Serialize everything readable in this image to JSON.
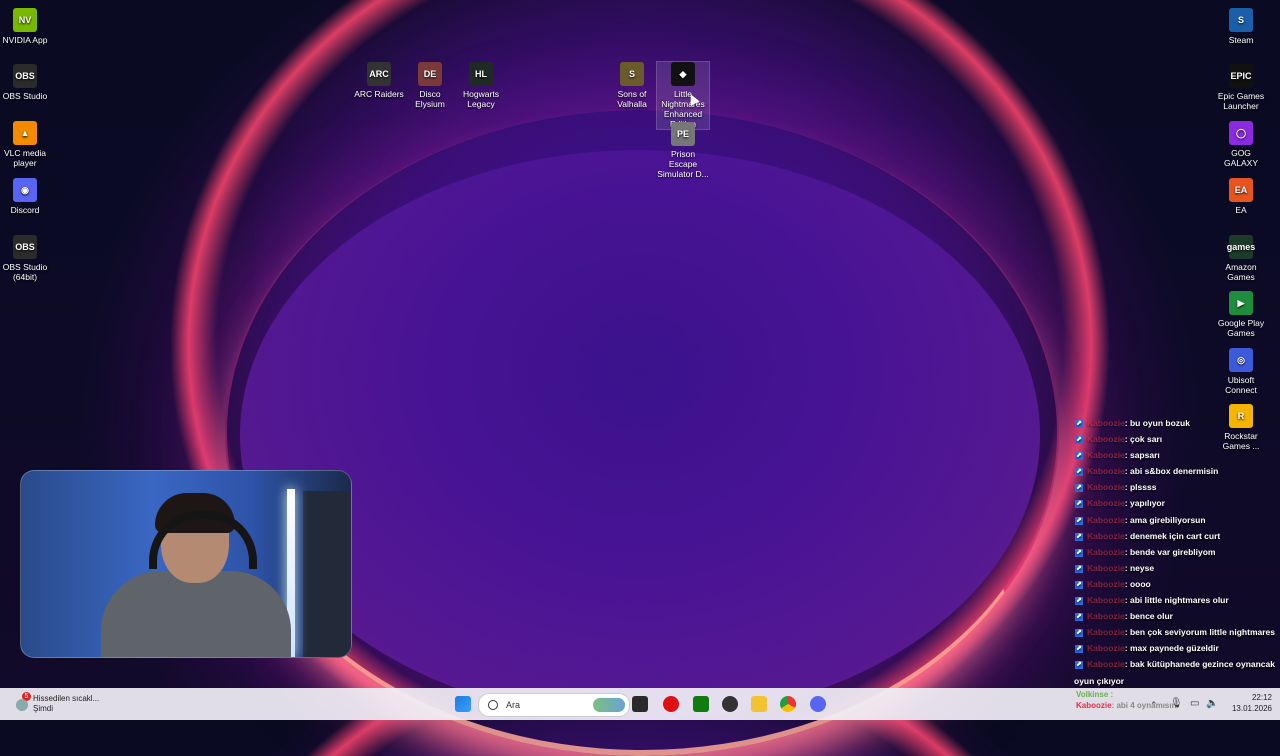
{
  "desktop_left_icons": [
    {
      "label": "NVIDIA App",
      "name": "nvidia-app-icon",
      "color": "#76b900",
      "glyph": "NV"
    },
    {
      "label": "OBS Studio",
      "name": "obs-studio-icon",
      "color": "#2b2b2b",
      "glyph": "OBS"
    },
    {
      "label": "VLC media player",
      "name": "vlc-icon",
      "color": "#f48a00",
      "glyph": "▲"
    },
    {
      "label": "Discord",
      "name": "discord-icon",
      "color": "#5865f2",
      "glyph": "◉"
    },
    {
      "label": "OBS Studio (64bit)",
      "name": "obs-studio-64-icon",
      "color": "#2b2b2b",
      "glyph": "OBS"
    }
  ],
  "desktop_mid_icons": [
    {
      "label": "ARC Raiders",
      "name": "arc-raiders-icon",
      "color": "#333",
      "glyph": "ARC"
    },
    {
      "label": "Disco Elysium",
      "name": "disco-elysium-icon",
      "color": "#7a3a3a",
      "glyph": "DE"
    },
    {
      "label": "Hogwarts Legacy",
      "name": "hogwarts-legacy-icon",
      "color": "#1f2a24",
      "glyph": "HL"
    },
    {
      "label": "Sons of Valhalla",
      "name": "sons-of-valhalla-icon",
      "color": "#6b5a2a",
      "glyph": "S"
    },
    {
      "label": "Little Nightmares Enhanced Edition",
      "name": "little-nightmares-icon",
      "color": "#111",
      "glyph": "◆"
    },
    {
      "label": "Prison Escape Simulator D...",
      "name": "prison-escape-icon",
      "color": "#777",
      "glyph": "PE"
    }
  ],
  "desktop_right_icons": [
    {
      "label": "Steam",
      "name": "steam-icon",
      "color": "#1b5fa8",
      "glyph": "S"
    },
    {
      "label": "Epic Games Launcher",
      "name": "epic-games-icon",
      "color": "#111",
      "glyph": "EPIC"
    },
    {
      "label": "GOG GALAXY",
      "name": "gog-galaxy-icon",
      "color": "#8a2be2",
      "glyph": "◯"
    },
    {
      "label": "EA",
      "name": "ea-icon",
      "color": "#e8541f",
      "glyph": "EA"
    },
    {
      "label": "Amazon Games",
      "name": "amazon-games-icon",
      "color": "#1e3a2a",
      "glyph": "games"
    },
    {
      "label": "Google Play Games",
      "name": "google-play-games-icon",
      "color": "#1e8e3e",
      "glyph": "▶"
    },
    {
      "label": "Ubisoft Connect",
      "name": "ubisoft-connect-icon",
      "color": "#3b5bdb",
      "glyph": "◎"
    },
    {
      "label": "Rockstar Games ...",
      "name": "rockstar-games-icon",
      "color": "#f5b400",
      "glyph": "R"
    }
  ],
  "chat": [
    {
      "user": "Kaboozie",
      "msg": ": bu oyun bozuk"
    },
    {
      "user": "Kaboozie",
      "msg": ": çok sarı"
    },
    {
      "user": "Kaboozie",
      "msg": ": sapsarı"
    },
    {
      "user": "Kaboozie",
      "msg": ": abi s&box denermisin"
    },
    {
      "user": "Kaboozie",
      "msg": ": plssss"
    },
    {
      "user": "Kaboozie",
      "msg": ": yapılıyor"
    },
    {
      "user": "Kaboozie",
      "msg": ": ama girebiliyorsun"
    },
    {
      "user": "Kaboozie",
      "msg": ": denemek için cart curt"
    },
    {
      "user": "Kaboozie",
      "msg": ": bende var girebliyom"
    },
    {
      "user": "Kaboozie",
      "msg": ": neyse"
    },
    {
      "user": "Kaboozie",
      "msg": ": oooo"
    },
    {
      "user": "Kaboozie",
      "msg": ": abi little nightmares olur"
    },
    {
      "user": "Kaboozie",
      "msg": ": bence olur"
    },
    {
      "user": "Kaboozie",
      "msg": ": ben çok seviyorum little nightmares"
    },
    {
      "user": "Kaboozie",
      "msg": ": max paynede güzeldir"
    },
    {
      "user": "Kaboozie",
      "msg": ": bak kütüphanede gezince oynancak"
    }
  ],
  "chat_tail": "oyun çıkıyor",
  "chat_footer": {
    "user1": "Volkinse :",
    "user2": "Kaboozie",
    "msg2": ": abi 4 oynamısın"
  },
  "weather": {
    "badge": "5",
    "line1": "Hissedilen sıcakl...",
    "line2": "Şimdi"
  },
  "search": {
    "placeholder": "Ara"
  },
  "clock": {
    "time": "22:12",
    "date": "13.01.2026"
  }
}
